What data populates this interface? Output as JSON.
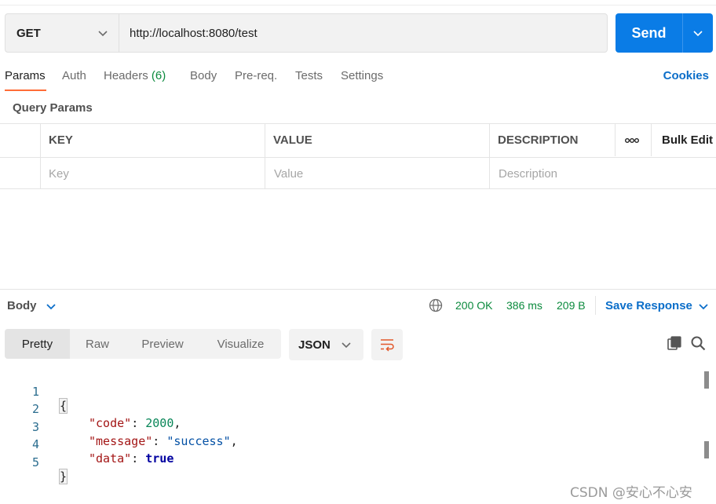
{
  "request": {
    "method": "GET",
    "url": "http://localhost:8080/test",
    "send_label": "Send"
  },
  "request_tabs": {
    "params": "Params",
    "auth": "Auth",
    "headers": "Headers",
    "headers_count": "(6)",
    "body": "Body",
    "prereq": "Pre-req.",
    "tests": "Tests",
    "settings": "Settings",
    "cookies": "Cookies"
  },
  "query_params": {
    "title": "Query Params",
    "columns": {
      "key": "KEY",
      "value": "VALUE",
      "description": "DESCRIPTION",
      "bulk_edit": "Bulk Edit"
    },
    "placeholders": {
      "key": "Key",
      "value": "Value",
      "description": "Description"
    }
  },
  "response": {
    "section_label": "Body",
    "status": "200 OK",
    "time": "386 ms",
    "size": "209 B",
    "save_label": "Save Response",
    "views": [
      "Pretty",
      "Raw",
      "Preview",
      "Visualize"
    ],
    "active_view": "Pretty",
    "format": "JSON",
    "lines": [
      {
        "num": "1"
      },
      {
        "num": "2",
        "key": "\"code\"",
        "value": "2000"
      },
      {
        "num": "3",
        "key": "\"message\"",
        "value": "\"success\""
      },
      {
        "num": "4",
        "key": "\"data\"",
        "value": "true"
      },
      {
        "num": "5"
      }
    ]
  },
  "colors": {
    "accent": "#ff6c37",
    "send_blue": "#0a7ce6",
    "status_green": "#0b8a3d",
    "link_blue": "#0b6ec9"
  },
  "icons": [
    "chevron-down-icon",
    "globe-icon",
    "wrap-lines-icon",
    "copy-icon",
    "search-icon",
    "more-icon"
  ],
  "watermark": "CSDN @安心不心安"
}
